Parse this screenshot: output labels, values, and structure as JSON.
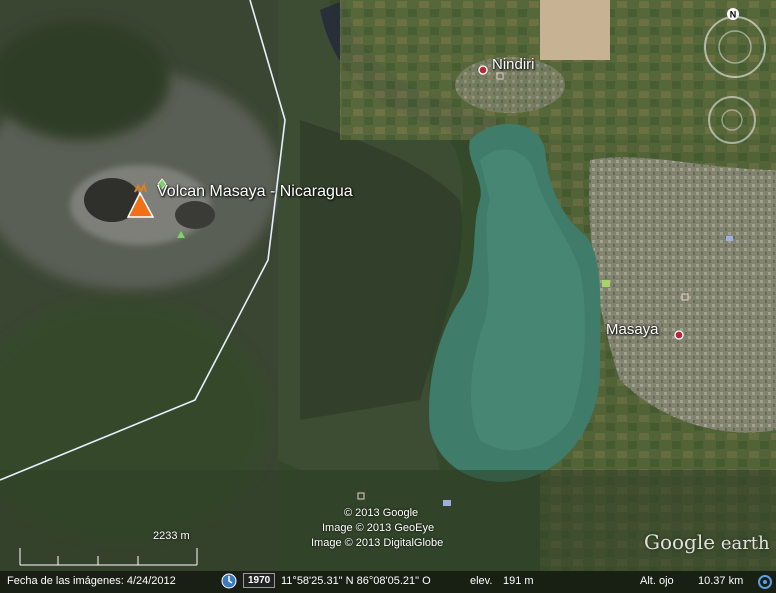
{
  "place_labels": {
    "title": "Volcan Masaya - Nicaragua",
    "nindiri": "Nindiri",
    "masaya": "Masaya"
  },
  "imagery_credits": [
    "© 2013 Google",
    "Image © 2013 GeoEye",
    "Image © 2013 DigitalGlobe"
  ],
  "scale_bar": {
    "label": "2233 m"
  },
  "logo": {
    "brand": "Google",
    "suffix": " earth"
  },
  "status_bar": {
    "imagery_date_label": "Fecha de las imágenes: 4/24/2012",
    "historical_year": "1970",
    "coordinates": "11°58'25.31\" N  86°08'05.21\" O",
    "elev_label": "elev.",
    "elev_value": "191 m",
    "eye_alt_label": "Alt. ojo",
    "eye_alt_value": "10.37 km"
  },
  "compass": {
    "north_letter": "N"
  },
  "icons": {
    "volcano": "volcano-icon",
    "clock": "clock-icon",
    "streaming": "streaming-icon",
    "compass": "compass-icon",
    "zoom": "zoom-ring-icon"
  },
  "colors": {
    "lagoon": "#3f7c6a",
    "border_line": "#e8eeff",
    "volcano_marker": "#f07018",
    "city_dot": "#b8263a"
  }
}
